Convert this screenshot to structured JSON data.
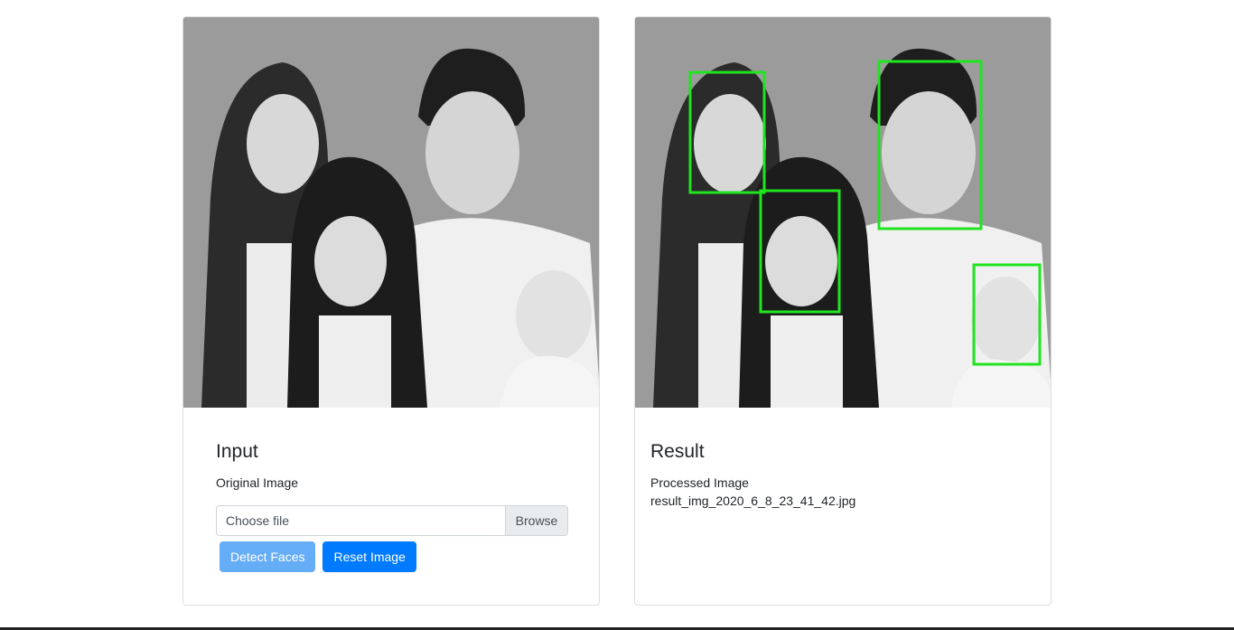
{
  "input_card": {
    "title": "Input",
    "subtitle": "Original Image",
    "file_placeholder": "Choose file",
    "browse_label": "Browse",
    "detect_button": "Detect Faces",
    "reset_button": "Reset Image"
  },
  "result_card": {
    "title": "Result",
    "subtitle": "Processed Image",
    "filename": "result_img_2020_6_8_23_41_42.jpg"
  },
  "colors": {
    "face_box": "#1fe51f",
    "primary": "#007bff",
    "primary_disabled": "#66adf7"
  }
}
